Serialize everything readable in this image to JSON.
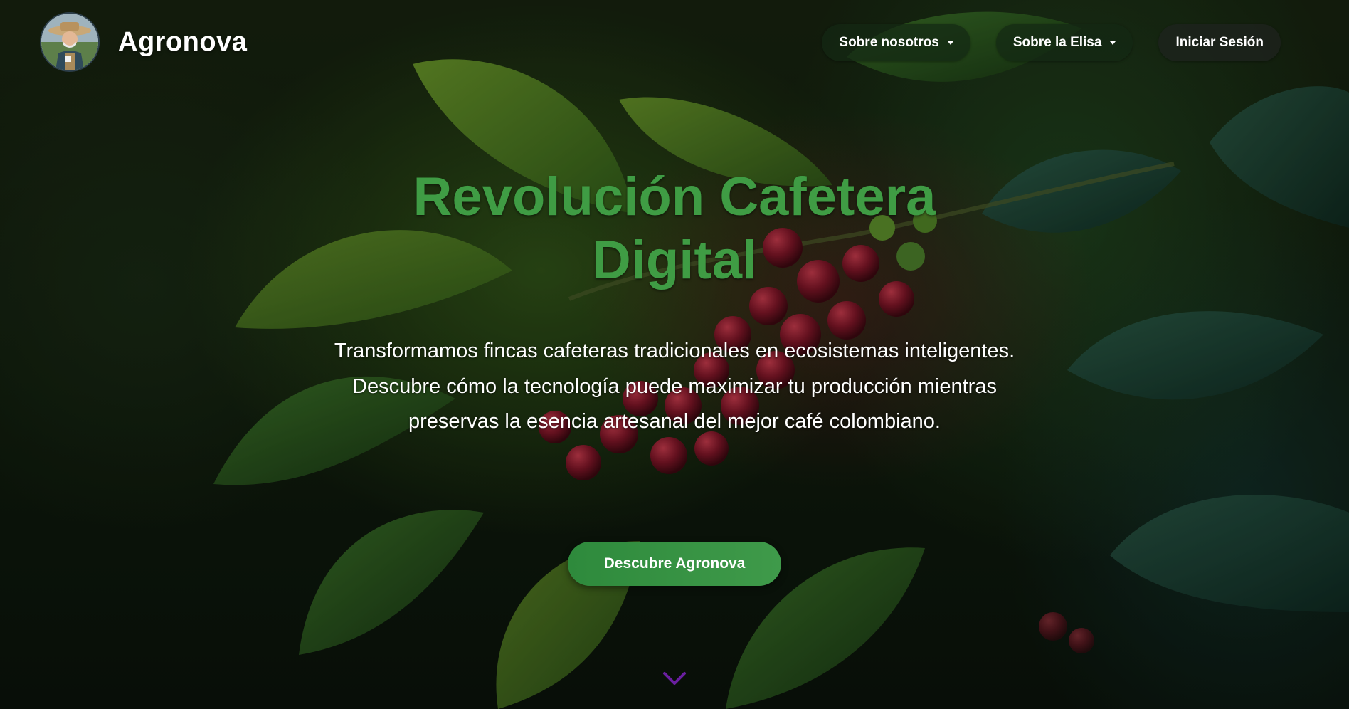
{
  "header": {
    "brand": "Agronova",
    "logo_icon": "farmer-avatar-icon"
  },
  "nav": {
    "about_us": "Sobre nosotros",
    "about_elisa": "Sobre la Elisa",
    "login": "Iniciar Sesión"
  },
  "hero": {
    "title_line1": "Revolución Cafetera",
    "title_line2": "Digital",
    "description": "Transformamos fincas cafeteras tradicionales en ecosistemas inteligentes. Descubre cómo la tecnología puede maximizar tu producción mientras preservas la esencia artesanal del mejor café colombiano.",
    "cta_label": "Descubre Agronova",
    "scroll_icon": "chevron-down-icon"
  },
  "colors": {
    "title": "#3f9c44",
    "cta": "#2e8a3c",
    "scroll_chevron": "#6a1fa0"
  }
}
